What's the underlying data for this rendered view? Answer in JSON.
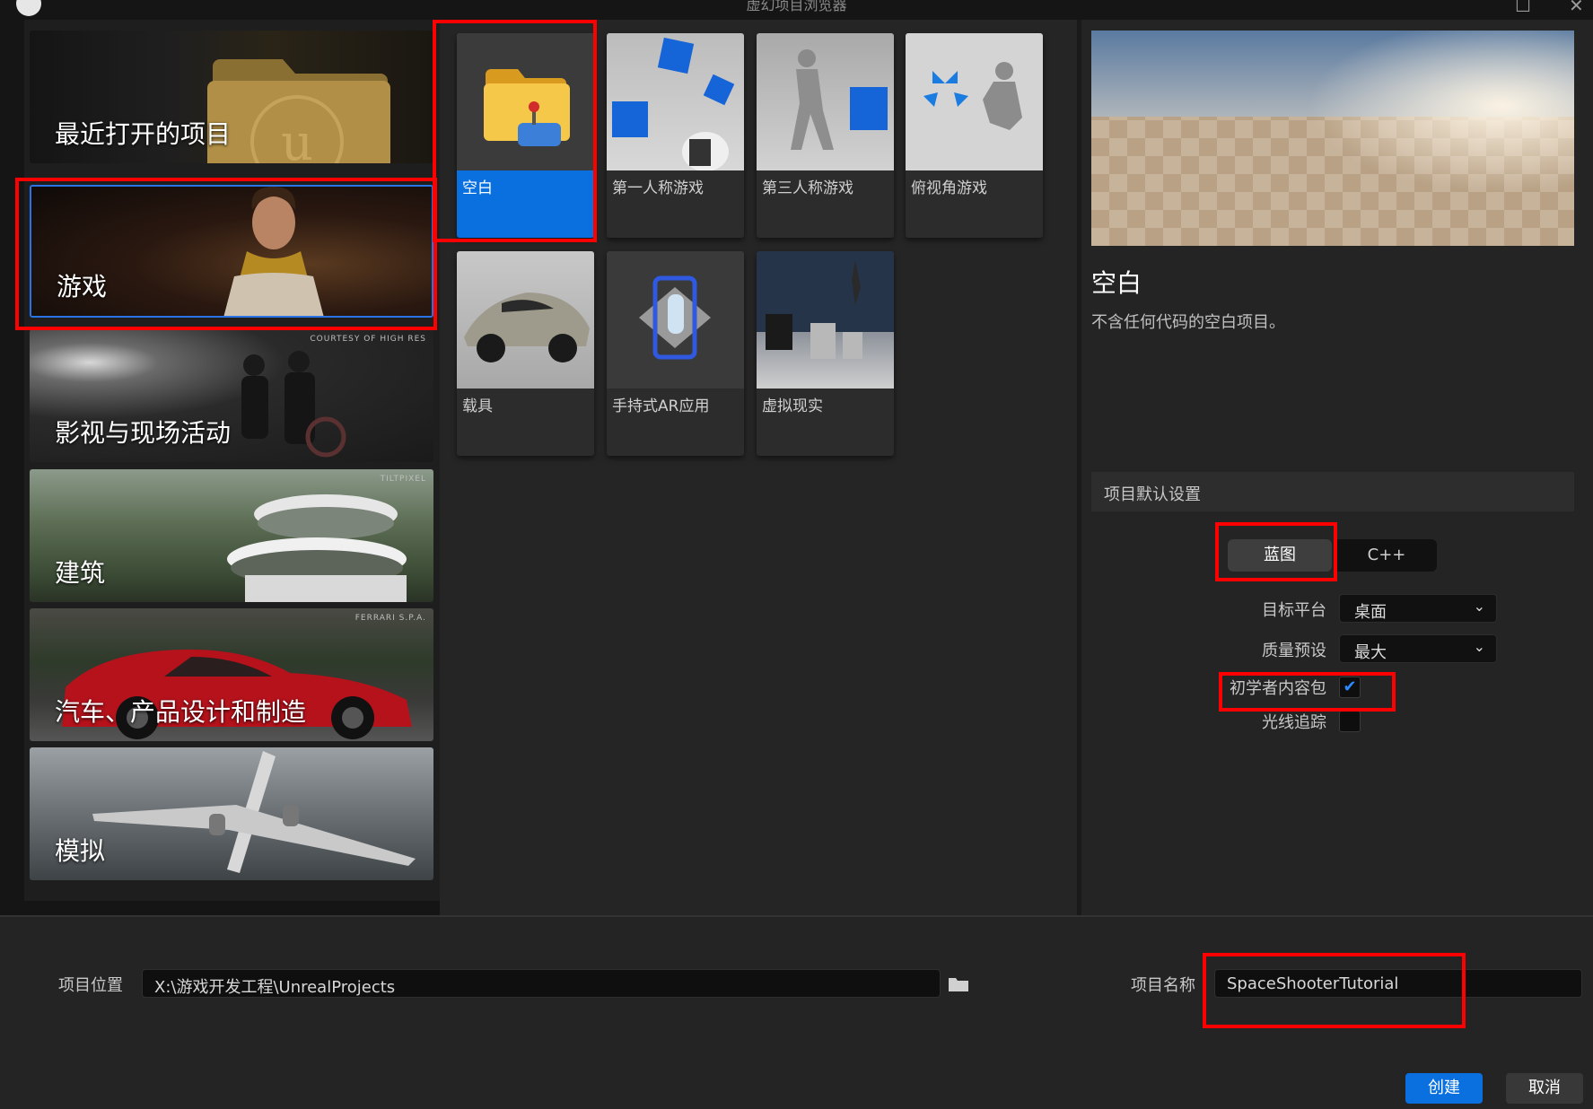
{
  "window": {
    "title": "虚幻项目浏览器",
    "maximize_glyph": "☐",
    "close_glyph": "✕"
  },
  "categories": [
    {
      "label": "最近打开的项目",
      "credit": ""
    },
    {
      "label": "游戏",
      "credit": ""
    },
    {
      "label": "影视与现场活动",
      "credit": "COURTESY OF HIGH RES"
    },
    {
      "label": "建筑",
      "credit": "TILTPIXEL"
    },
    {
      "label": "汽车、产品设计和制造",
      "credit": "FERRARI S.P.A."
    },
    {
      "label": "模拟",
      "credit": ""
    }
  ],
  "templates": [
    {
      "label": "空白",
      "icon": "folder-controller-icon",
      "selected": true
    },
    {
      "label": "第一人称游戏",
      "icon": "first-person-icon"
    },
    {
      "label": "第三人称游戏",
      "icon": "third-person-icon"
    },
    {
      "label": "俯视角游戏",
      "icon": "top-down-icon"
    },
    {
      "label": "载具",
      "icon": "vehicle-icon"
    },
    {
      "label": "手持式AR应用",
      "icon": "ar-phone-icon"
    },
    {
      "label": "虚拟现实",
      "icon": "vr-icon"
    }
  ],
  "details": {
    "title": "空白",
    "description": "不含任何代码的空白项目。",
    "defaults_header": "项目默认设置",
    "blueprint_label": "蓝图",
    "cpp_label": "C++",
    "target_platform_label": "目标平台",
    "target_platform_value": "桌面",
    "quality_label": "质量预设",
    "quality_value": "最大",
    "starter_content_label": "初学者内容包",
    "starter_content_checked": true,
    "raytracing_label": "光线追踪",
    "raytracing_checked": false
  },
  "bottom": {
    "location_label": "项目位置",
    "location_value": "X:\\游戏开发工程\\UnrealProjects",
    "name_label": "项目名称",
    "name_value": "SpaceShooterTutorial",
    "create_label": "创建",
    "cancel_label": "取消"
  },
  "colors": {
    "accent": "#0a70e0",
    "highlight": "#ff0000"
  }
}
